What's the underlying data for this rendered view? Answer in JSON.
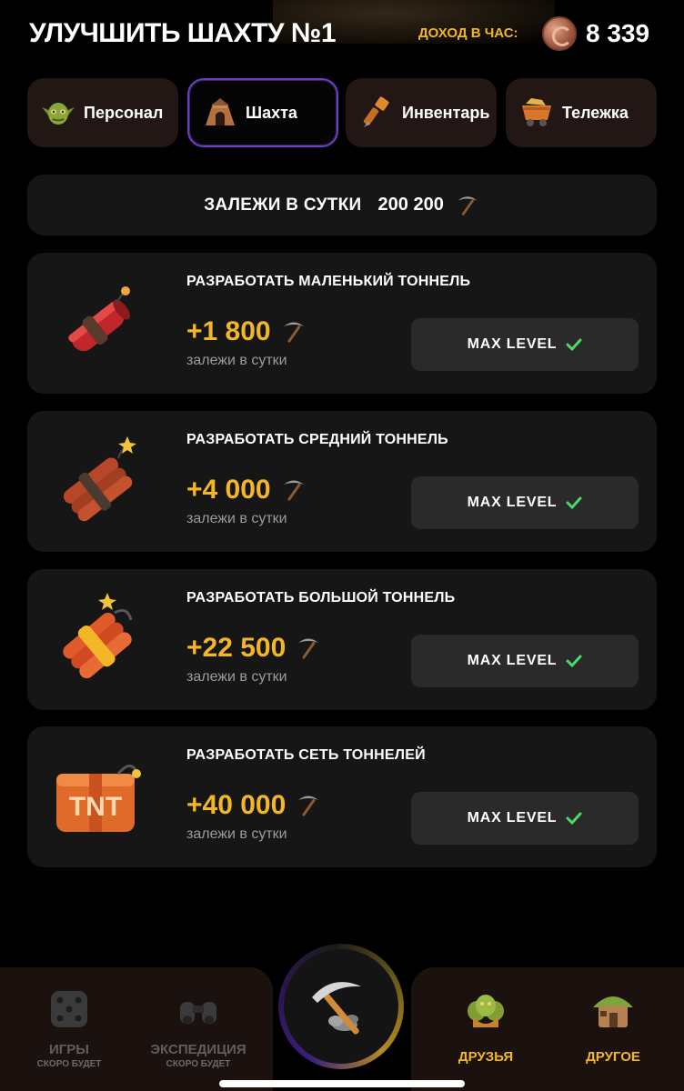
{
  "header": {
    "title": "УЛУЧШИТЬ ШАХТУ №1",
    "income_label": "ДОХОД В ЧАС:",
    "income_value": "8 339",
    "coin_icon": "copper-coin-icon"
  },
  "tabs": [
    {
      "label": "Персонал",
      "icon": "goblin-icon",
      "active": false
    },
    {
      "label": "Шахта",
      "icon": "mine-icon",
      "active": true
    },
    {
      "label": "Инвентарь",
      "icon": "drill-icon",
      "active": false
    },
    {
      "label": "Тележка",
      "icon": "minecart-icon",
      "active": false
    }
  ],
  "deposits": {
    "label": "ЗАЛЕЖИ В СУТКИ",
    "value": "200 200",
    "icon": "pickaxe-icon"
  },
  "upgrades": [
    {
      "title": "РАЗРАБОТАТЬ МАЛЕНЬКИЙ ТОННЕЛЬ",
      "amount": "+1 800",
      "sub": "залежи в сутки",
      "button": "MAX LEVEL",
      "icon": "dynamite-small-icon"
    },
    {
      "title": "РАЗРАБОТАТЬ СРЕДНИЙ ТОННЕЛЬ",
      "amount": "+4 000",
      "sub": "залежи в сутки",
      "button": "MAX LEVEL",
      "icon": "dynamite-medium-icon"
    },
    {
      "title": "РАЗРАБОТАТЬ БОЛЬШОЙ ТОННЕЛЬ",
      "amount": "+22 500",
      "sub": "залежи в сутки",
      "button": "MAX LEVEL",
      "icon": "dynamite-large-icon"
    },
    {
      "title": "РАЗРАБОТАТЬ СЕТЬ ТОННЕЛЕЙ",
      "amount": "+40 000",
      "sub": "залежи в сутки",
      "button": "MAX LEVEL",
      "icon": "tnt-box-icon"
    }
  ],
  "nav": {
    "games": {
      "label": "ИГРЫ",
      "sub": "СКОРО БУДЕТ",
      "icon": "dice-icon"
    },
    "expedition": {
      "label": "ЭКСПЕДИЦИЯ",
      "sub": "СКОРО БУДЕТ",
      "icon": "binoculars-icon"
    },
    "center": {
      "icon": "pickaxe-icon"
    },
    "friends": {
      "label": "ДРУЗЬЯ",
      "icon": "goblins-icon"
    },
    "other": {
      "label": "ДРУГОЕ",
      "icon": "hut-icon"
    }
  },
  "colors": {
    "accent": "#f2b626",
    "card": "#161616",
    "tab": "#221714",
    "active_border": "#6a3fbf",
    "check": "#4cd964"
  }
}
